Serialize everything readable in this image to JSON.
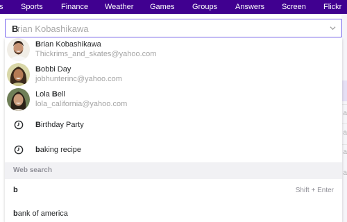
{
  "nav": {
    "items": [
      "s",
      "Sports",
      "Finance",
      "Weather",
      "Games",
      "Groups",
      "Answers",
      "Screen",
      "Flickr"
    ]
  },
  "search": {
    "typed": "B",
    "suggestion_rest": "rian Kobashikawa"
  },
  "dropdown": {
    "contacts": [
      {
        "name_bold": "B",
        "name_rest": "rian Kobashikawa",
        "email": "Thickrims_and_skates@yahoo.com"
      },
      {
        "name_bold": "B",
        "name_rest": "obbi Day",
        "email": "jobhunterinc@yahoo.com"
      },
      {
        "name_pre": "Lola ",
        "name_bold": "B",
        "name_rest": "ell",
        "email": "lola_california@yahoo.com"
      }
    ],
    "history": [
      {
        "bold": "B",
        "rest": "irthday Party"
      },
      {
        "bold": "b",
        "rest": "aking recipe"
      }
    ],
    "web_search_header": "Web search",
    "web_search": [
      {
        "bold": "b",
        "rest": "",
        "hint": "Shift + Enter"
      },
      {
        "bold": "b",
        "rest": "ank of america"
      }
    ]
  },
  "background": {
    "chars": [
      "a",
      "a",
      "a",
      "a"
    ]
  },
  "colors": {
    "nav_bg": "#400090",
    "focus_border": "#7b68ee",
    "section_bg": "#f1f1f4"
  }
}
